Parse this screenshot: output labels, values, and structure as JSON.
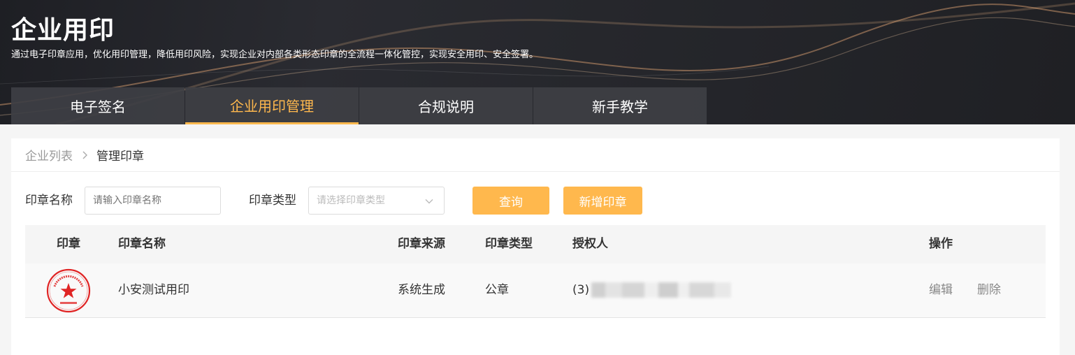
{
  "hero": {
    "title": "企业用印",
    "description": "通过电子印章应用，优化用印管理，降低用印风险，实现企业对内部各类形态印章的全流程一体化管控，实现安全用印、安全签署。"
  },
  "tabs": [
    {
      "label": "电子签名",
      "active": false
    },
    {
      "label": "企业用印管理",
      "active": true
    },
    {
      "label": "合规说明",
      "active": false
    },
    {
      "label": "新手教学",
      "active": false
    }
  ],
  "breadcrumb": {
    "parent": "企业列表",
    "current": "管理印章"
  },
  "filter": {
    "name_label": "印章名称",
    "name_placeholder": "请输入印章名称",
    "type_label": "印章类型",
    "type_placeholder": "请选择印章类型",
    "query_button": "查询",
    "add_button": "新增印章"
  },
  "table": {
    "headers": {
      "seal": "印章",
      "name": "印章名称",
      "source": "印章来源",
      "type": "印章类型",
      "authorized": "授权人",
      "actions": "操作"
    },
    "rows": [
      {
        "name": "小安测试用印",
        "source": "系统生成",
        "type": "公章",
        "authorized_prefix": "(3)",
        "edit": "编辑",
        "delete": "删除"
      }
    ]
  },
  "colors": {
    "accent": "#ffb84d",
    "seal_red": "#e02424",
    "hero_bg": "#232429"
  },
  "icons": {
    "breadcrumb_separator": "chevron-right-icon",
    "select_arrow": "chevron-down-icon",
    "seal": "seal-stamp-icon"
  }
}
